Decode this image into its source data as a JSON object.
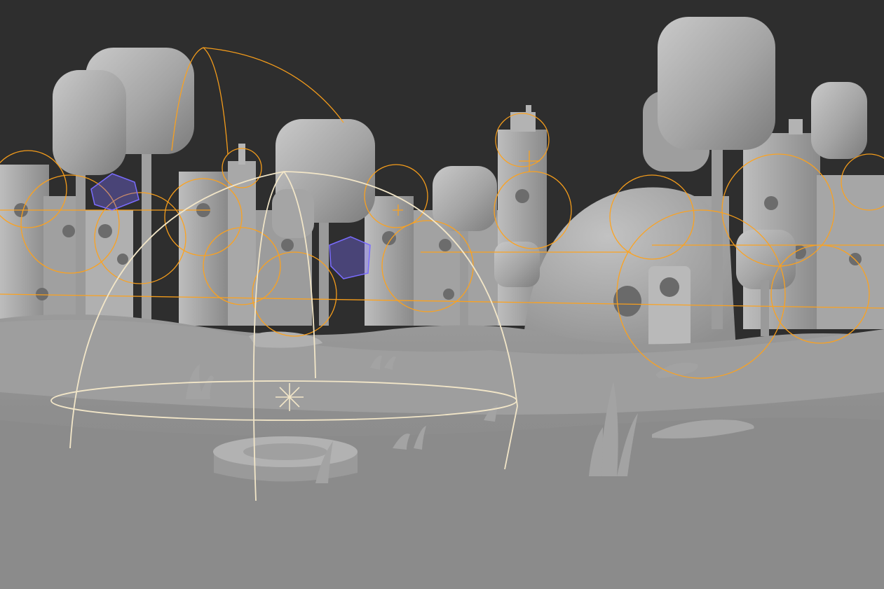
{
  "viewport": {
    "mode": "solid-shading",
    "background_color": "#2e2e2e",
    "ground_color": "#8f8f8f",
    "model_color": "#a9a9a9",
    "light_gizmo_color": "#ffa21a",
    "selected_light_color": "#f2e6c8",
    "camera_gizmo_color": "#7a6cff"
  },
  "scene": {
    "objects": [
      {
        "kind": "tree",
        "icon": "tree-icon"
      },
      {
        "kind": "building-stack",
        "icon": "building-icon"
      },
      {
        "kind": "hill",
        "icon": "hill-icon"
      },
      {
        "kind": "grass-tuft",
        "icon": "grass-icon"
      },
      {
        "kind": "rock",
        "icon": "rock-icon"
      },
      {
        "kind": "stump",
        "icon": "stump-icon"
      }
    ],
    "selected_object": {
      "kind": "area-light",
      "icon": "sun-icon"
    }
  }
}
